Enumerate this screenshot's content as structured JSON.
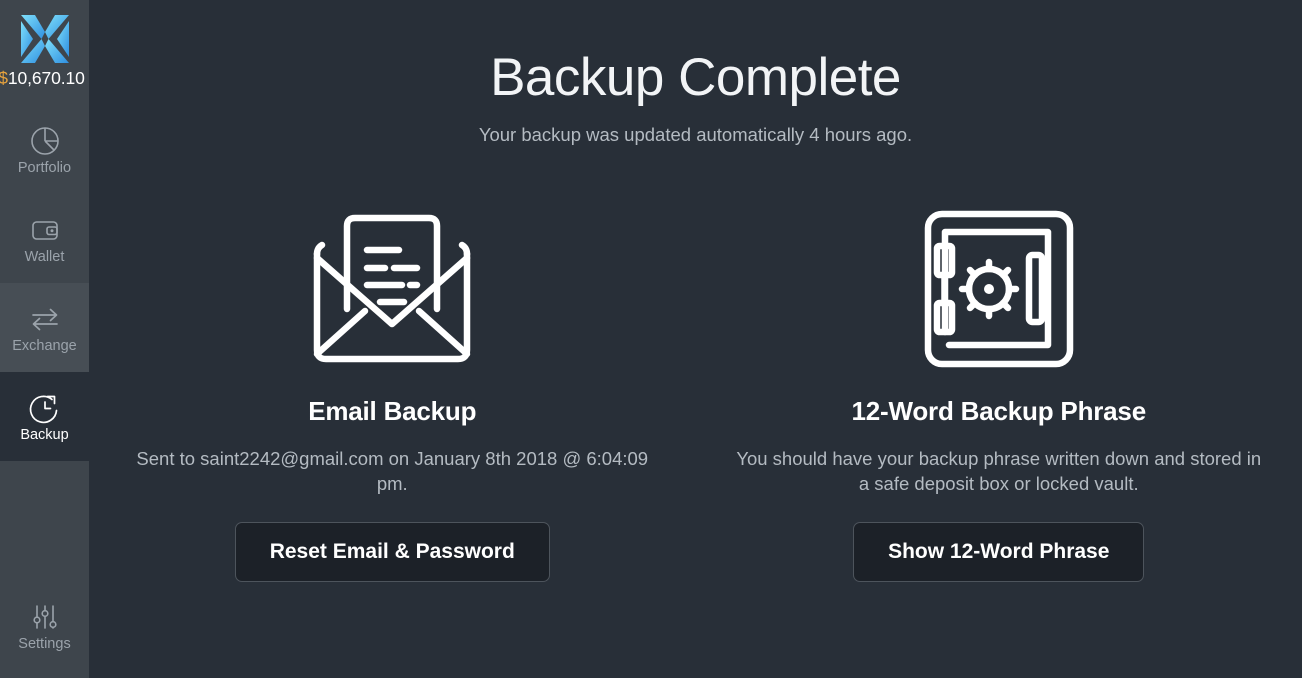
{
  "sidebar": {
    "logo_name": "exodus-logo",
    "balance": {
      "currency_symbol": "$",
      "amount": "10,670.10",
      "amount_color": "#ffffff",
      "symbol_color": "#e8a33d"
    },
    "items": [
      {
        "label": "Portfolio",
        "icon": "pie-chart-icon",
        "state": "default"
      },
      {
        "label": "Wallet",
        "icon": "wallet-icon",
        "state": "default"
      },
      {
        "label": "Exchange",
        "icon": "exchange-arrows-icon",
        "state": "hover"
      },
      {
        "label": "Backup",
        "icon": "backup-restore-clock-icon",
        "state": "active"
      }
    ],
    "settings": {
      "label": "Settings",
      "icon": "sliders-icon"
    }
  },
  "main": {
    "title": "Backup Complete",
    "subtitle": "Your backup was updated automatically 4 hours ago.",
    "cards": [
      {
        "icon": "open-envelope-letter-icon",
        "title": "Email Backup",
        "description": "Sent to saint2242@gmail.com on January 8th 2018 @ 6:04:09 pm.",
        "button_label": "Reset Email & Password"
      },
      {
        "icon": "safe-vault-icon",
        "title": "12-Word Backup Phrase",
        "description": "You should have your backup phrase written down and stored in a safe deposit box or locked vault.",
        "button_label": "Show 12-Word Phrase"
      }
    ]
  },
  "colors": {
    "sidebar_bg": "#3e454c",
    "main_bg": "#282f38",
    "accent_blue": "#3bb3ef",
    "button_bg": "#1c2128",
    "muted_text": "#b4bbc2"
  }
}
